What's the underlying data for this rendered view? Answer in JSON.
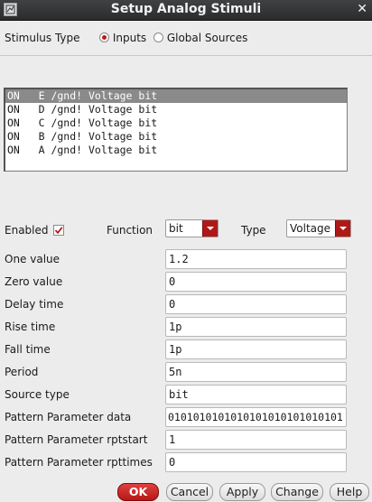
{
  "window": {
    "title": "Setup Analog Stimuli",
    "close_glyph": "✕"
  },
  "stimulus_type": {
    "label": "Stimulus Type",
    "options": [
      {
        "label": "Inputs",
        "selected": true
      },
      {
        "label": "Global Sources",
        "selected": false
      }
    ]
  },
  "stimuli_list": [
    "ON   E /gnd! Voltage bit",
    "ON   D /gnd! Voltage bit",
    "ON   C /gnd! Voltage bit",
    "ON   B /gnd! Voltage bit",
    "ON   A /gnd! Voltage bit"
  ],
  "form": {
    "enabled_label": "Enabled",
    "enabled_checked": true,
    "function_label": "Function",
    "function_value": "bit",
    "type_label": "Type",
    "type_value": "Voltage",
    "fields": [
      {
        "label": "One value",
        "value": "1.2"
      },
      {
        "label": "Zero value",
        "value": "0"
      },
      {
        "label": "Delay time",
        "value": "0"
      },
      {
        "label": "Rise time",
        "value": "1p"
      },
      {
        "label": "Fall time",
        "value": "1p"
      },
      {
        "label": "Period",
        "value": "5n"
      },
      {
        "label": "Source type",
        "value": "bit"
      },
      {
        "label": "Pattern Parameter data",
        "value": "0101010101010101010101010101"
      },
      {
        "label": "Pattern Parameter rptstart",
        "value": "1"
      },
      {
        "label": "Pattern Parameter rpttimes",
        "value": "0"
      }
    ]
  },
  "buttons": {
    "ok": "OK",
    "cancel": "Cancel",
    "apply": "Apply",
    "change": "Change",
    "help": "Help"
  },
  "colors": {
    "accent": "#b51815",
    "titlebar": "#2f3032",
    "selection": "#8a8a8a"
  }
}
